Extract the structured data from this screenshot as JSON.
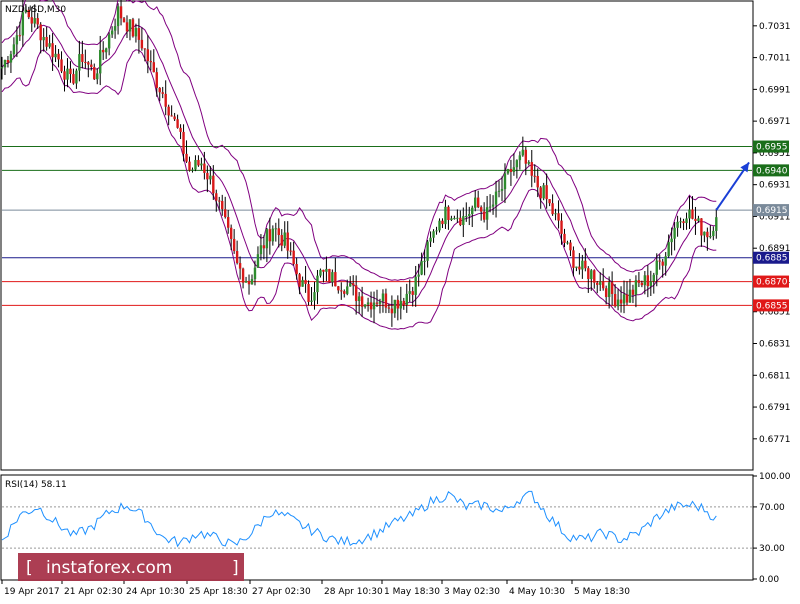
{
  "symbol_label": "NZDUSD,M30",
  "rsi_label": "RSI(14) 58.11",
  "watermark_text": "instaforex.com",
  "chart_data": [
    {
      "type": "candlestick",
      "title": "NZDUSD,M30",
      "ylim": [
        0.6752,
        0.7046
      ],
      "y_ticks": [
        "0.7031",
        "0.7011",
        "0.6991",
        "0.6971",
        "0.6951",
        "0.6931",
        "0.6911",
        "0.6891",
        "0.6871",
        "0.6851",
        "0.6831",
        "0.6811",
        "0.6791",
        "0.6771"
      ],
      "x_tick_labels": [
        "19 Apr 2017",
        "21 Apr 02:30",
        "24 Apr 10:30",
        "25 Apr 18:30",
        "27 Apr 02:30",
        "28 Apr 10:30",
        "1 May 18:30",
        "3 May 02:30",
        "4 May 10:30",
        "5 May 18:30"
      ],
      "levels": [
        {
          "value": 0.6955,
          "label": "0.6955",
          "color": "#1a6e1a"
        },
        {
          "value": 0.694,
          "label": "0.6940",
          "color": "#1a6e1a"
        },
        {
          "value": 0.6915,
          "label": "0.6915",
          "color": "#7a8a9a"
        },
        {
          "value": 0.6885,
          "label": "0.6885",
          "color": "#1a1a8c"
        },
        {
          "value": 0.687,
          "label": "0.6870",
          "color": "#e01818"
        },
        {
          "value": 0.6855,
          "label": "0.6855",
          "color": "#e01818"
        }
      ],
      "path": [
        [
          0,
          0.7005
        ],
        [
          4,
          0.702
        ],
        [
          8,
          0.704
        ],
        [
          12,
          0.703
        ],
        [
          16,
          0.7018
        ],
        [
          19,
          0.701
        ],
        [
          23,
          0.6995
        ],
        [
          27,
          0.7012
        ],
        [
          31,
          0.7
        ],
        [
          35,
          0.702
        ],
        [
          39,
          0.704
        ],
        [
          43,
          0.703
        ],
        [
          47,
          0.702
        ],
        [
          51,
          0.7
        ],
        [
          55,
          0.6985
        ],
        [
          59,
          0.6965
        ],
        [
          63,
          0.694
        ],
        [
          67,
          0.6945
        ],
        [
          71,
          0.693
        ],
        [
          75,
          0.6905
        ],
        [
          79,
          0.688
        ],
        [
          83,
          0.687
        ],
        [
          87,
          0.689
        ],
        [
          91,
          0.6905
        ],
        [
          95,
          0.6895
        ],
        [
          99,
          0.6875
        ],
        [
          103,
          0.686
        ],
        [
          107,
          0.6875
        ],
        [
          111,
          0.6872
        ],
        [
          115,
          0.6868
        ],
        [
          119,
          0.6862
        ],
        [
          123,
          0.6857
        ],
        [
          127,
          0.686
        ],
        [
          131,
          0.6856
        ],
        [
          135,
          0.686
        ],
        [
          139,
          0.687
        ],
        [
          143,
          0.689
        ],
        [
          147,
          0.691
        ],
        [
          151,
          0.6915
        ],
        [
          155,
          0.691
        ],
        [
          159,
          0.6918
        ],
        [
          163,
          0.6912
        ],
        [
          167,
          0.6925
        ],
        [
          171,
          0.694
        ],
        [
          175,
          0.6948
        ],
        [
          178,
          0.6935
        ],
        [
          182,
          0.6925
        ],
        [
          186,
          0.691
        ],
        [
          190,
          0.689
        ],
        [
          194,
          0.6878
        ],
        [
          198,
          0.6875
        ],
        [
          202,
          0.6868
        ],
        [
          206,
          0.686
        ],
        [
          210,
          0.686
        ],
        [
          214,
          0.6868
        ],
        [
          218,
          0.6872
        ],
        [
          222,
          0.6885
        ],
        [
          226,
          0.6905
        ],
        [
          230,
          0.6915
        ],
        [
          234,
          0.6905
        ],
        [
          238,
          0.69
        ],
        [
          240,
          0.6915
        ]
      ],
      "bollinger_width": 0.0028,
      "projection_arrow": {
        "from": [
          240,
          0.6915
        ],
        "to": [
          251,
          0.6945
        ],
        "color": "#1a3fd6"
      }
    },
    {
      "type": "line",
      "title": "RSI(14) 58.11",
      "ylim": [
        0,
        100
      ],
      "y_ticks": [
        "100.00",
        "70.00",
        "30.00",
        "0.00"
      ],
      "levels": [
        70,
        30
      ],
      "path": [
        [
          0,
          38
        ],
        [
          6,
          62
        ],
        [
          12,
          70
        ],
        [
          18,
          55
        ],
        [
          24,
          42
        ],
        [
          30,
          50
        ],
        [
          36,
          65
        ],
        [
          42,
          72
        ],
        [
          48,
          60
        ],
        [
          54,
          40
        ],
        [
          60,
          35
        ],
        [
          66,
          45
        ],
        [
          72,
          40
        ],
        [
          78,
          32
        ],
        [
          84,
          45
        ],
        [
          90,
          65
        ],
        [
          96,
          60
        ],
        [
          102,
          50
        ],
        [
          108,
          42
        ],
        [
          114,
          36
        ],
        [
          120,
          38
        ],
        [
          126,
          45
        ],
        [
          132,
          55
        ],
        [
          138,
          62
        ],
        [
          144,
          75
        ],
        [
          150,
          82
        ],
        [
          156,
          70
        ],
        [
          162,
          72
        ],
        [
          168,
          65
        ],
        [
          174,
          78
        ],
        [
          178,
          82
        ],
        [
          184,
          60
        ],
        [
          190,
          42
        ],
        [
          196,
          38
        ],
        [
          202,
          45
        ],
        [
          208,
          38
        ],
        [
          214,
          45
        ],
        [
          220,
          60
        ],
        [
          226,
          70
        ],
        [
          232,
          72
        ],
        [
          236,
          68
        ],
        [
          240,
          58
        ]
      ],
      "line_color": "#1e90ff"
    }
  ]
}
